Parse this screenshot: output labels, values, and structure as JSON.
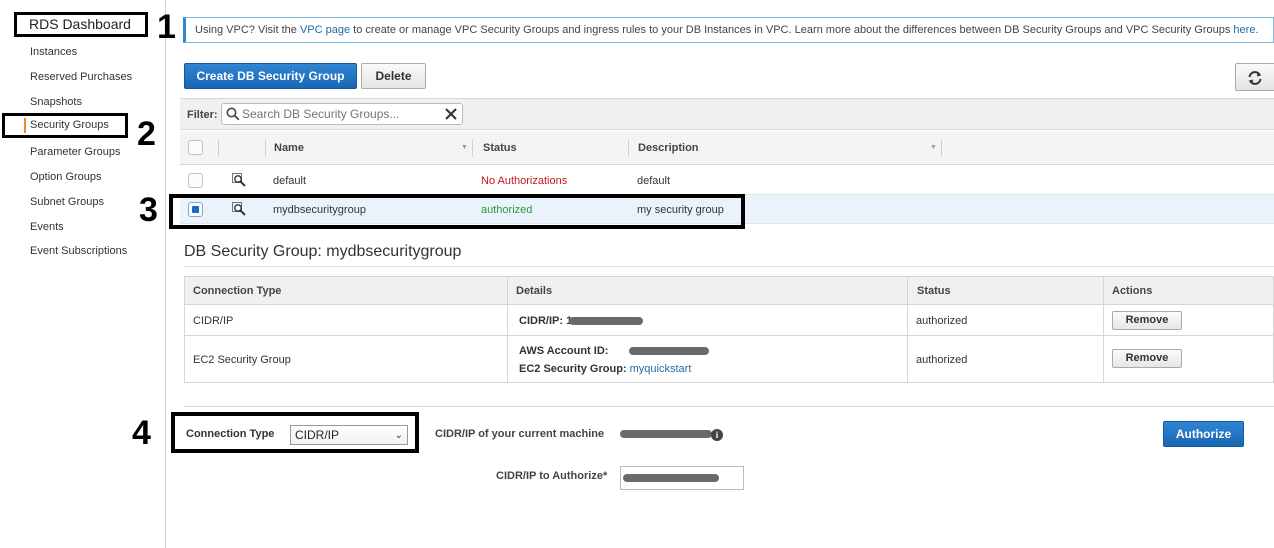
{
  "sidebar": {
    "title": "RDS Dashboard",
    "items": [
      {
        "label": "Instances"
      },
      {
        "label": "Reserved Purchases"
      },
      {
        "label": "Snapshots"
      },
      {
        "label": "Security Groups",
        "active": true
      },
      {
        "label": "Parameter Groups"
      },
      {
        "label": "Option Groups"
      },
      {
        "label": "Subnet Groups"
      },
      {
        "label": "Events"
      },
      {
        "label": "Event Subscriptions"
      }
    ]
  },
  "annotations": [
    "1",
    "2",
    "3",
    "4"
  ],
  "banner": {
    "text1": "Using VPC? Visit the ",
    "link1": "VPC page",
    "text2": " to create or manage VPC Security Groups and ingress rules to your DB Instances in VPC. Learn more about the differences between DB Security Groups and VPC Security Groups ",
    "link2": "here",
    "text3": "."
  },
  "toolbar": {
    "create_label": "Create DB Security Group",
    "delete_label": "Delete",
    "refresh_icon": "refresh-icon"
  },
  "filter": {
    "label": "Filter:",
    "placeholder": "Search DB Security Groups..."
  },
  "table": {
    "columns": [
      "Name",
      "Status",
      "Description"
    ],
    "rows": [
      {
        "name": "default",
        "status": "No Authorizations",
        "description": "default",
        "selected": false
      },
      {
        "name": "mydbsecuritygroup",
        "status": "authorized",
        "description": "my security group",
        "selected": true
      }
    ]
  },
  "detail": {
    "title": "DB Security Group: mydbsecuritygroup",
    "columns": [
      "Connection Type",
      "Details",
      "Status",
      "Actions"
    ],
    "rows": [
      {
        "type": "CIDR/IP",
        "detail_label": "CIDR/IP:",
        "detail_prefix": "1",
        "status": "authorized",
        "action": "Remove"
      },
      {
        "type": "EC2 Security Group",
        "account_label": "AWS Account ID:",
        "group_label": "EC2 Security Group:",
        "group_value": "myquickstart",
        "status": "authorized",
        "action": "Remove"
      }
    ]
  },
  "form": {
    "connection_type_label": "Connection Type",
    "connection_type_value": "CIDR/IP",
    "current_machine_label": "CIDR/IP of your current machine",
    "authorize_label": "CIDR/IP to Authorize*",
    "authorize_button": "Authorize"
  },
  "colors": {
    "primary": "#1a66b3",
    "authorized": "#2a9a3a",
    "error": "#c21a1a",
    "link": "#1f6ba8"
  }
}
